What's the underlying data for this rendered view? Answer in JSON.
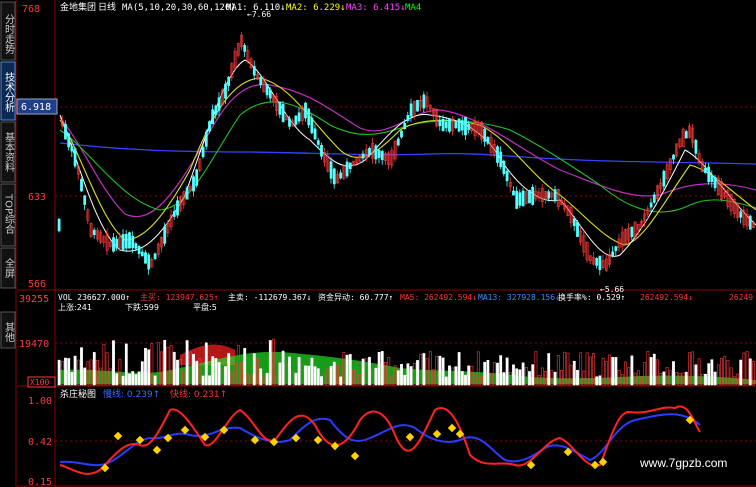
{
  "sidebar": {
    "tabs": [
      {
        "label": "分时走势",
        "active": false
      },
      {
        "label": "技术分析",
        "active": true
      },
      {
        "label": "基本资料",
        "active": false
      },
      {
        "label": "TOP综合",
        "active": false
      },
      {
        "label": "全屏",
        "active": false
      },
      {
        "label": "其他",
        "active": false
      }
    ],
    "current_price_box": "6.918"
  },
  "price_panel": {
    "stock_name": "金地集团",
    "period": "日线",
    "ma_params": "MA(5,10,20,30,60,120)",
    "ma_values": [
      {
        "label": "MA1: 6.110↓",
        "color": "#ffffff"
      },
      {
        "label": "MA2: 6.229↓",
        "color": "#ffff00"
      },
      {
        "label": "MA3: 6.415↓",
        "color": "#ff44ff"
      },
      {
        "label": "MA4",
        "color": "#00ff00"
      }
    ],
    "y_labels": [
      "768",
      "6.918",
      "633",
      "566"
    ],
    "high_marker": "←7.66",
    "low_marker": "←5.66"
  },
  "volume_panel": {
    "header": [
      {
        "label": "VOL 236627.000↑",
        "color": "#ffffff"
      },
      {
        "label": "主买: 123947.625↑",
        "color": "#ff3333"
      },
      {
        "label": "主卖: -112679.367↓",
        "color": "#ffffff"
      },
      {
        "label": "资金异动: 60.777↑",
        "color": "#ffffff"
      },
      {
        "label": "MA5: 262492.594↓",
        "color": "#ff3333"
      },
      {
        "label": "MA13: 327928.156↓",
        "color": "#3b8cff"
      },
      {
        "label": "换手率%: 0.529↑",
        "color": "#ffffff"
      },
      {
        "label": "262492.594↓",
        "color": "#ff3333"
      },
      {
        "label": "26249",
        "color": "#ff3333"
      }
    ],
    "sub_labels": {
      "up": "上涨:241",
      "down": "下跌:599",
      "flat": "平盘:5"
    },
    "y_labels": [
      "39255",
      "19470",
      "X100"
    ]
  },
  "indicator_panel": {
    "name": "杀庄秘图",
    "line1": "慢线: 0.239↑",
    "line2": "快线: 0.231↑",
    "y_labels": [
      "1.00",
      "0.42",
      "0.15"
    ]
  },
  "watermark": "www.7gpzb.com",
  "colors": {
    "up": "#ff3b3b",
    "down": "#54ffff",
    "grid": "#8b0000",
    "axis_text": "#ff3b3b",
    "volume_green": "#22dd22"
  },
  "chart_data": {
    "type": "candlestick",
    "price_range": [
      5.66,
      7.68
    ],
    "volume_max": 39255,
    "indicator_range": [
      0.15,
      1.0
    ]
  }
}
